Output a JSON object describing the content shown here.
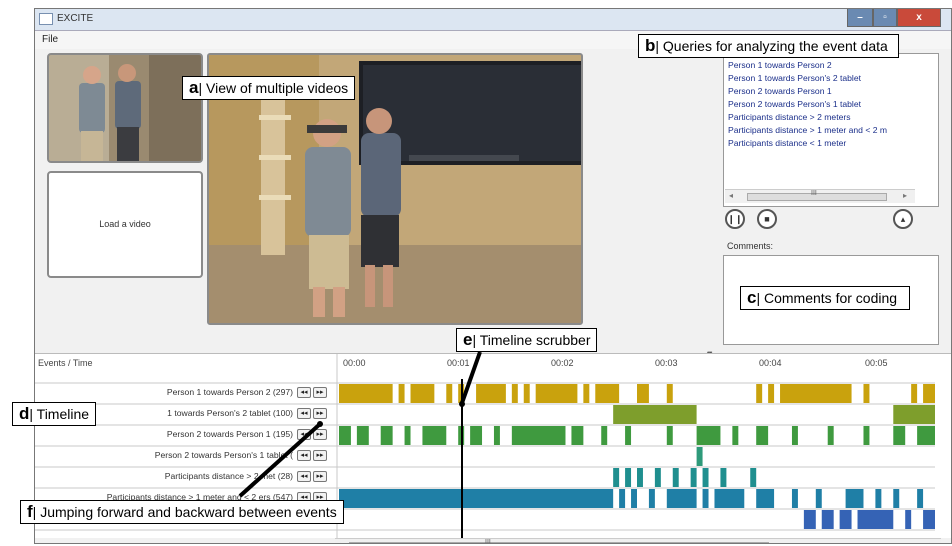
{
  "window": {
    "title": "EXCITE",
    "menu_file": "File"
  },
  "videos": {
    "load_label": "Load a video"
  },
  "queries": {
    "items": [
      "Person 1 towards Person 2",
      "Person 1 towards Person's 2 tablet",
      "Person 2 towards Person 1",
      "Person 2 towards Person's 1 tablet",
      "Participants distance > 2 meters",
      "Participants distance > 1 meter and < 2 m",
      "Participants distance < 1 meter"
    ]
  },
  "comments": {
    "label": "Comments:"
  },
  "timeline": {
    "header_label": "Events / Time",
    "ticks": [
      "00:00",
      "00:01",
      "00:02",
      "00:03",
      "00:04",
      "00:05"
    ],
    "rows": [
      {
        "label": "Person 1 towards Person 2 (297)",
        "color": "#c9a20d"
      },
      {
        "label": "1 towards Person's 2 tablet (100)",
        "color": "#7e9e2c"
      },
      {
        "label": "Person 2 towards Person 1 (195)",
        "color": "#3f9a3f"
      },
      {
        "label": "Person 2 towards Person's 1 tablet (",
        "color": "#2e9a7a"
      },
      {
        "label": "Participants distance > 2 met   (28)",
        "color": "#1f8f8f"
      },
      {
        "label": "Participants distance > 1 meter and < 2   ers (547)",
        "color": "#1f7fa6"
      },
      {
        "label": "",
        "color": "#3563b5"
      }
    ],
    "nav_back_glyph": "◂◂",
    "nav_fwd_glyph": "▸▸"
  },
  "callouts": {
    "a_letter": "a",
    "a_text": "| View of multiple videos",
    "b_letter": "b",
    "b_text": "| Queries for analyzing the event data",
    "c_letter": "c",
    "c_text": "| Comments for coding",
    "d_letter": "d",
    "d_text": "| Timeline",
    "e_letter": "e",
    "e_text": "| Timeline scrubber",
    "f_letter": "f",
    "f_text": "| Jumping forward and backward between events"
  },
  "scrollbars": {
    "grip": "III"
  },
  "icons": {
    "pause": "pause-icon",
    "stop": "stop-icon",
    "eject": "eject-icon",
    "cursor": "mouse-pointer-icon",
    "app": "app-icon"
  }
}
